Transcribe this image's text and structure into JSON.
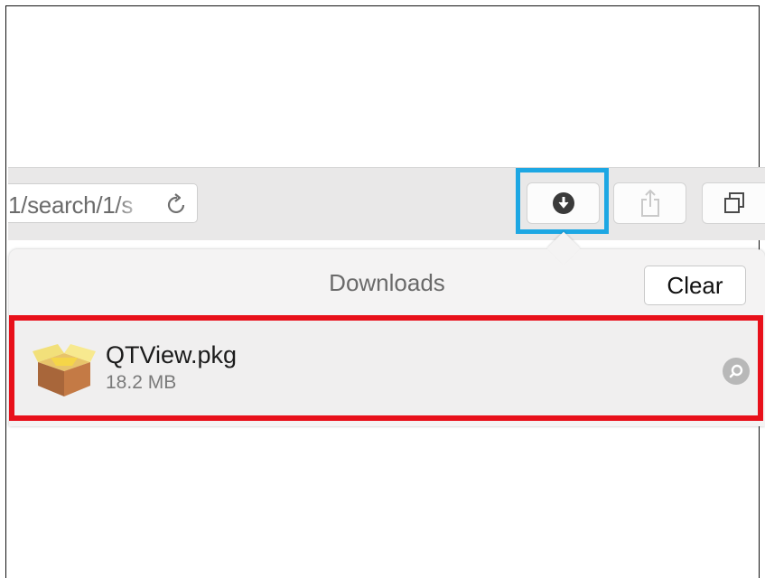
{
  "address_bar": {
    "url_text": "1/search/1/s"
  },
  "toolbar": {
    "reload_icon": "reload-icon",
    "downloads_icon": "download-arrow-icon",
    "share_icon": "share-icon",
    "tabs_icon": "tabs-overview-icon"
  },
  "downloads_popover": {
    "title": "Downloads",
    "clear_label": "Clear",
    "items": [
      {
        "file_name": "QTView.pkg",
        "file_size": "18.2 MB",
        "icon": "package-icon",
        "reveal_icon": "magnifier-icon"
      }
    ]
  },
  "annotations": {
    "downloads_button_highlight": "#1da7e3",
    "download_item_highlight": "#e8101a"
  }
}
